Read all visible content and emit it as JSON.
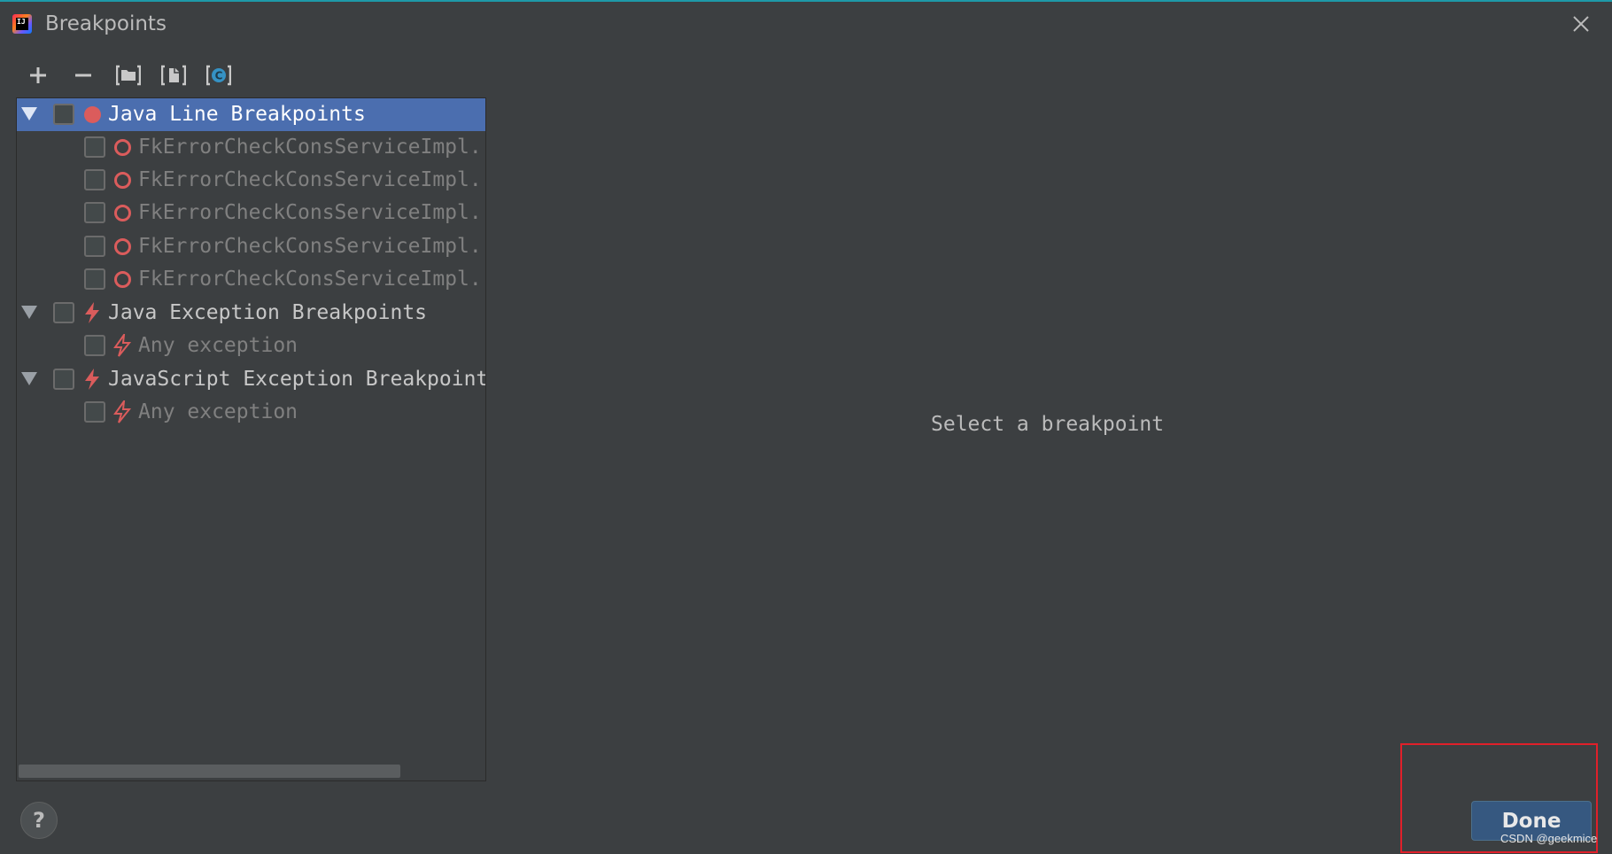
{
  "window": {
    "title": "Breakpoints",
    "app_icon_text": "IJ"
  },
  "toolbar": {
    "items": [
      {
        "icon": "plus-icon"
      },
      {
        "icon": "minus-icon"
      },
      {
        "icon": "group-by-package-icon"
      },
      {
        "icon": "group-by-file-icon"
      },
      {
        "icon": "group-by-class-icon"
      }
    ]
  },
  "tree": {
    "groups": [
      {
        "label": "Java Line Breakpoints",
        "icon": "breakpoint-filled-icon",
        "expanded": true,
        "selected": true,
        "children": [
          {
            "label": "FkErrorCheckConsServiceImpl.",
            "icon": "breakpoint-hollow-icon"
          },
          {
            "label": "FkErrorCheckConsServiceImpl.",
            "icon": "breakpoint-hollow-icon"
          },
          {
            "label": "FkErrorCheckConsServiceImpl.",
            "icon": "breakpoint-hollow-icon"
          },
          {
            "label": "FkErrorCheckConsServiceImpl.",
            "icon": "breakpoint-hollow-icon"
          },
          {
            "label": "FkErrorCheckConsServiceImpl.",
            "icon": "breakpoint-hollow-icon"
          }
        ]
      },
      {
        "label": "Java Exception Breakpoints",
        "icon": "exception-bolt-icon",
        "expanded": true,
        "selected": false,
        "children": [
          {
            "label": "Any exception",
            "icon": "exception-bolt-outline-icon"
          }
        ]
      },
      {
        "label": "JavaScript Exception Breakpoint",
        "icon": "exception-bolt-icon",
        "expanded": true,
        "selected": false,
        "children": [
          {
            "label": "Any exception",
            "icon": "exception-bolt-outline-icon"
          }
        ]
      }
    ]
  },
  "details": {
    "placeholder": "Select a breakpoint"
  },
  "footer": {
    "help_label": "?",
    "done_label": "Done"
  },
  "watermark": "CSDN @geekmice",
  "colors": {
    "background": "#3c3f41",
    "selection": "#4b6eaf",
    "breakpoint_red": "#db5c5c",
    "done_button": "#365880",
    "highlight_box": "#e0202a"
  }
}
